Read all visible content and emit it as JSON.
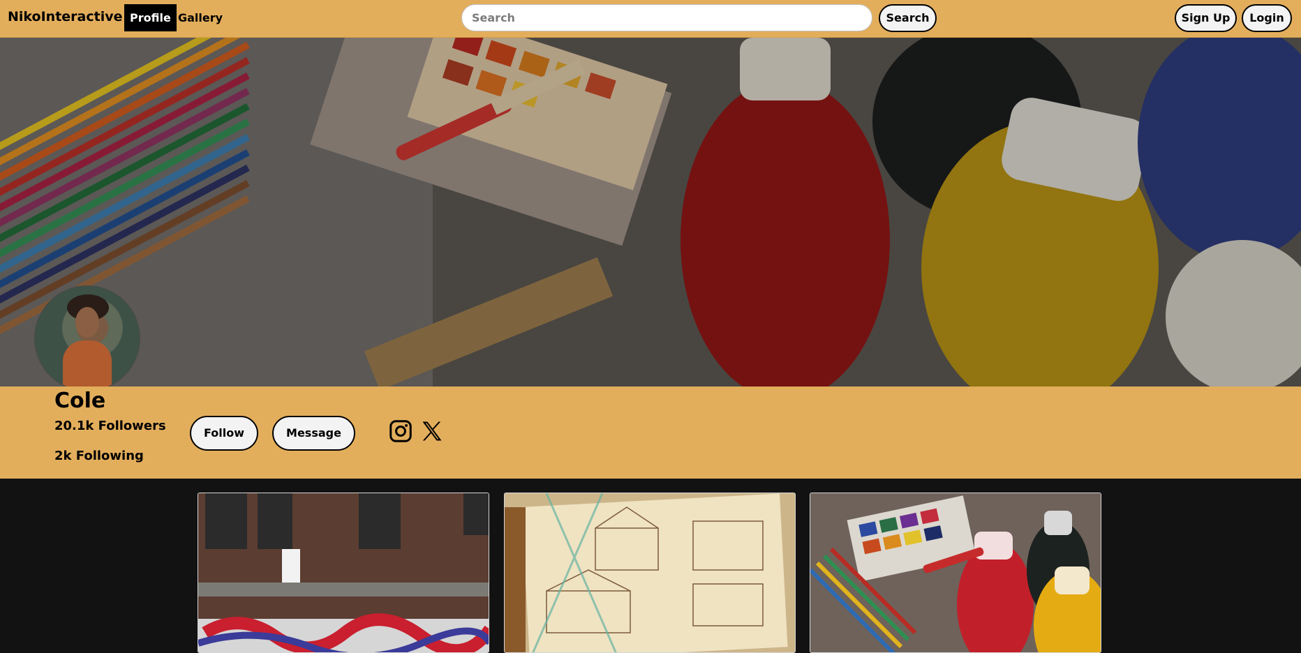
{
  "header": {
    "brand": "NikoInteractive",
    "nav": {
      "profile": "Profile",
      "gallery": "Gallery"
    },
    "search": {
      "placeholder": "Search",
      "value": "",
      "button": "Search"
    },
    "auth": {
      "signup": "Sign Up",
      "login": "Login"
    }
  },
  "profile": {
    "name": "Cole",
    "followers": "20.1k Followers",
    "following": "2k Following",
    "follow_button": "Follow",
    "message_button": "Message",
    "social_icons": [
      "instagram-icon",
      "x-icon"
    ]
  },
  "gallery": {
    "items": [
      {
        "alt": "Graffiti wall and brick building"
      },
      {
        "alt": "Architectural sketch drawing"
      },
      {
        "alt": "Paints and pencils"
      }
    ]
  },
  "colors": {
    "accent": "#E3AE5C",
    "page_background": "#121212",
    "active_nav": "#000000"
  }
}
